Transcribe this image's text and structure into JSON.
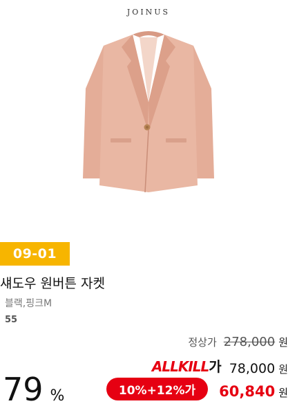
{
  "product": {
    "brand": "JOINUS",
    "image_icon": "pink-jacket-image",
    "date_badge": "09-01",
    "title": "섀도우 원버튼 자켓",
    "colors": "블랙,핑크M",
    "size": "55"
  },
  "pricing": {
    "regular_label": "정상가",
    "regular_price": "278,000",
    "regular_unit": "원",
    "allkill_logo_prefix": "ALLKILL",
    "allkill_logo_suffix": "가",
    "allkill_price": "78,000",
    "allkill_unit": "원",
    "coupon_label": "10%+12%가",
    "final_price": "60,840",
    "final_unit": "원",
    "discount_value": "79",
    "discount_unit": "%"
  },
  "colors": {
    "badge": "#f7b500",
    "accent_red": "#e60012",
    "jacket": "#e9b7a3"
  }
}
